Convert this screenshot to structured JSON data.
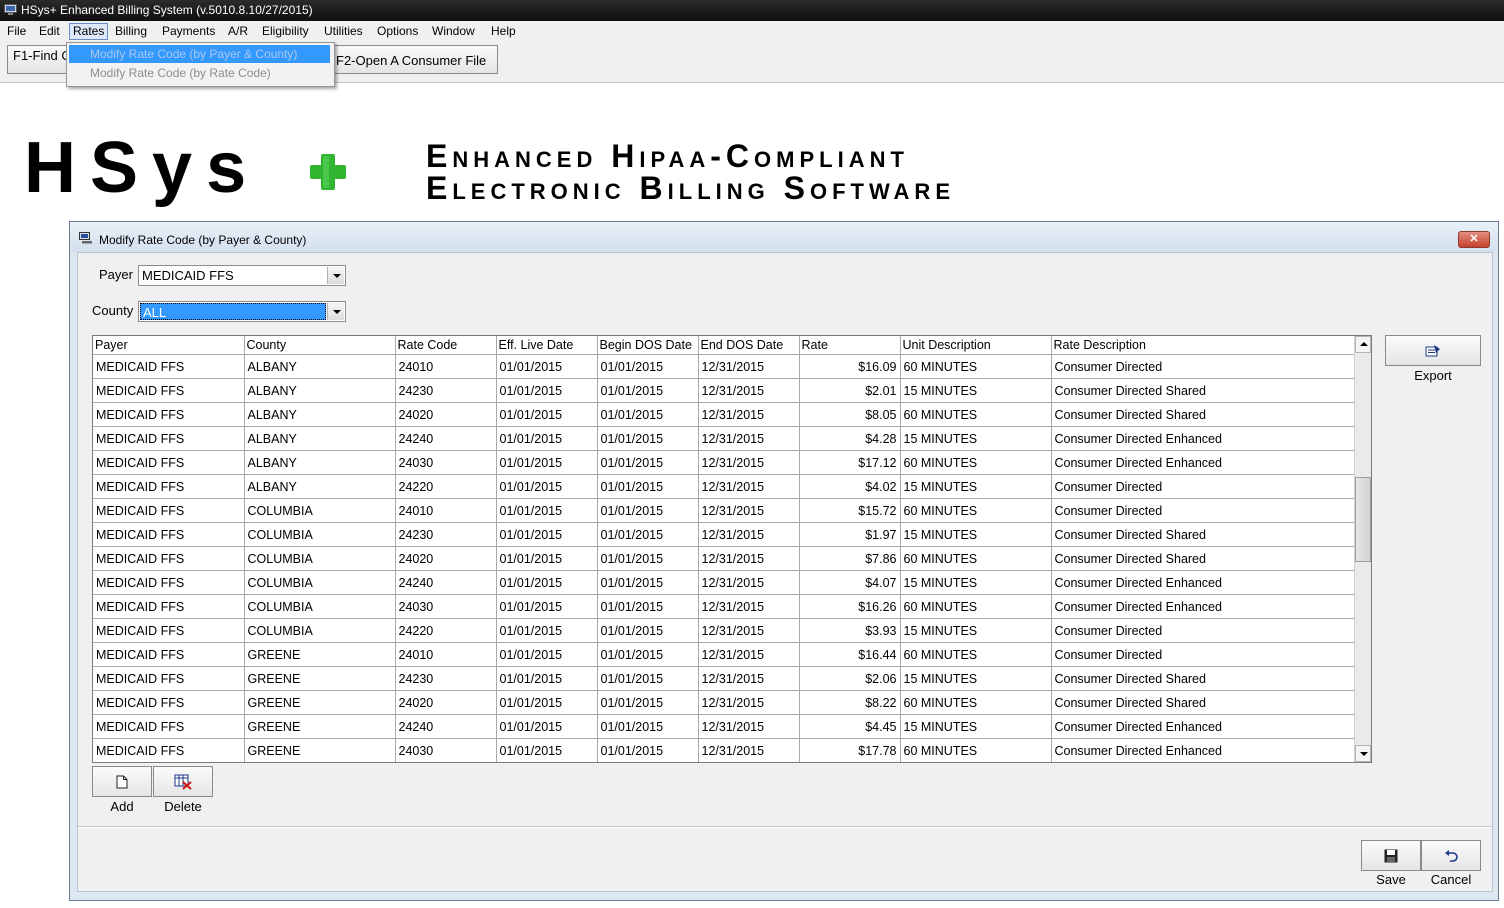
{
  "window": {
    "title": "HSys+ Enhanced Billing System (v.5010.8.10/27/2015)"
  },
  "menubar": {
    "items": [
      {
        "label": "File",
        "name": "menu-file"
      },
      {
        "label": "Edit",
        "name": "menu-edit"
      },
      {
        "label": "Rates",
        "name": "menu-rates"
      },
      {
        "label": "Billing",
        "name": "menu-billing"
      },
      {
        "label": "Payments",
        "name": "menu-payments"
      },
      {
        "label": "A/R",
        "name": "menu-ar"
      },
      {
        "label": "Eligibility",
        "name": "menu-eligibility"
      },
      {
        "label": "Utilities",
        "name": "menu-utilities"
      },
      {
        "label": "Options",
        "name": "menu-options"
      },
      {
        "label": "Window",
        "name": "menu-window"
      },
      {
        "label": "Help",
        "name": "menu-help"
      }
    ]
  },
  "rates_menu": {
    "items": [
      {
        "label": "Modify Rate Code (by Payer & County)"
      },
      {
        "label": "Modify Rate Code (by Rate Code)"
      }
    ]
  },
  "toolbar": {
    "f1_label": "F1-Find C",
    "f2_label": "F2-Open A Consumer File"
  },
  "banner": {
    "logo_text": "HSys",
    "tagline_1": "Enhanced Hipaa-Compliant",
    "tagline_2": "Electronic Billing Software",
    "plus_color": "#2fb52f"
  },
  "dialog": {
    "title": "Modify Rate Code (by Payer & County)",
    "payer_label": "Payer",
    "payer_value": "MEDICAID FFS",
    "county_label": "County",
    "county_value": "ALL",
    "export_label": "Export",
    "add_label": "Add",
    "delete_label": "Delete",
    "save_label": "Save",
    "cancel_label": "Cancel",
    "close_glyph": "✕"
  },
  "grid": {
    "columns": [
      "Payer",
      "County",
      "Rate Code",
      "Eff. Live Date",
      "Begin DOS Date",
      "End DOS Date",
      "Rate",
      "Unit Description",
      "Rate Description"
    ],
    "rows": [
      [
        "MEDICAID FFS",
        "ALBANY",
        "24010",
        "01/01/2015",
        "01/01/2015",
        "12/31/2015",
        "$16.09",
        "60 MINUTES",
        "Consumer Directed"
      ],
      [
        "MEDICAID FFS",
        "ALBANY",
        "24230",
        "01/01/2015",
        "01/01/2015",
        "12/31/2015",
        "$2.01",
        "15 MINUTES",
        "Consumer Directed Shared"
      ],
      [
        "MEDICAID FFS",
        "ALBANY",
        "24020",
        "01/01/2015",
        "01/01/2015",
        "12/31/2015",
        "$8.05",
        "60 MINUTES",
        "Consumer Directed Shared"
      ],
      [
        "MEDICAID FFS",
        "ALBANY",
        "24240",
        "01/01/2015",
        "01/01/2015",
        "12/31/2015",
        "$4.28",
        "15 MINUTES",
        "Consumer Directed Enhanced"
      ],
      [
        "MEDICAID FFS",
        "ALBANY",
        "24030",
        "01/01/2015",
        "01/01/2015",
        "12/31/2015",
        "$17.12",
        "60 MINUTES",
        "Consumer Directed Enhanced"
      ],
      [
        "MEDICAID FFS",
        "ALBANY",
        "24220",
        "01/01/2015",
        "01/01/2015",
        "12/31/2015",
        "$4.02",
        "15 MINUTES",
        "Consumer Directed"
      ],
      [
        "MEDICAID FFS",
        "COLUMBIA",
        "24010",
        "01/01/2015",
        "01/01/2015",
        "12/31/2015",
        "$15.72",
        "60 MINUTES",
        "Consumer Directed"
      ],
      [
        "MEDICAID FFS",
        "COLUMBIA",
        "24230",
        "01/01/2015",
        "01/01/2015",
        "12/31/2015",
        "$1.97",
        "15 MINUTES",
        "Consumer Directed Shared"
      ],
      [
        "MEDICAID FFS",
        "COLUMBIA",
        "24020",
        "01/01/2015",
        "01/01/2015",
        "12/31/2015",
        "$7.86",
        "60 MINUTES",
        "Consumer Directed Shared"
      ],
      [
        "MEDICAID FFS",
        "COLUMBIA",
        "24240",
        "01/01/2015",
        "01/01/2015",
        "12/31/2015",
        "$4.07",
        "15 MINUTES",
        "Consumer Directed Enhanced"
      ],
      [
        "MEDICAID FFS",
        "COLUMBIA",
        "24030",
        "01/01/2015",
        "01/01/2015",
        "12/31/2015",
        "$16.26",
        "60 MINUTES",
        "Consumer Directed Enhanced"
      ],
      [
        "MEDICAID FFS",
        "COLUMBIA",
        "24220",
        "01/01/2015",
        "01/01/2015",
        "12/31/2015",
        "$3.93",
        "15 MINUTES",
        "Consumer Directed"
      ],
      [
        "MEDICAID FFS",
        "GREENE",
        "24010",
        "01/01/2015",
        "01/01/2015",
        "12/31/2015",
        "$16.44",
        "60 MINUTES",
        "Consumer Directed"
      ],
      [
        "MEDICAID FFS",
        "GREENE",
        "24230",
        "01/01/2015",
        "01/01/2015",
        "12/31/2015",
        "$2.06",
        "15 MINUTES",
        "Consumer Directed Shared"
      ],
      [
        "MEDICAID FFS",
        "GREENE",
        "24020",
        "01/01/2015",
        "01/01/2015",
        "12/31/2015",
        "$8.22",
        "60 MINUTES",
        "Consumer Directed Shared"
      ],
      [
        "MEDICAID FFS",
        "GREENE",
        "24240",
        "01/01/2015",
        "01/01/2015",
        "12/31/2015",
        "$4.45",
        "15 MINUTES",
        "Consumer Directed Enhanced"
      ],
      [
        "MEDICAID FFS",
        "GREENE",
        "24030",
        "01/01/2015",
        "01/01/2015",
        "12/31/2015",
        "$17.78",
        "60 MINUTES",
        "Consumer Directed Enhanced"
      ]
    ]
  },
  "icons": {
    "app": "app-icon",
    "dialog": "computer-icon",
    "export": "export-icon",
    "add": "new-document-icon",
    "delete": "delete-icon",
    "save": "floppy-disk-icon",
    "cancel": "undo-icon"
  }
}
